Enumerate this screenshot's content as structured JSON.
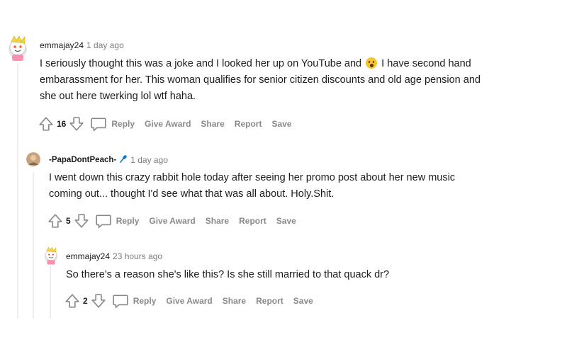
{
  "comments": [
    {
      "username": "emmajay24",
      "time": "1 day ago",
      "text_lines": [
        [
          "I seriously thought this was a joke and I looked her up on YouTube and ",
          "I have second hand"
        ],
        "embarassment for her. This woman qualifies for senior citizen discounts and old age pension and",
        "she out here twerking lol wtf haha."
      ],
      "emoji": "astonished-face-emoji",
      "score": "16",
      "actions": {
        "reply": "Reply",
        "award": "Give Award",
        "share": "Share",
        "report": "Report",
        "save": "Save"
      }
    },
    {
      "username": "-PapaDontPeach-",
      "time": "1 day ago",
      "flair_icon": "microphone-icon",
      "text_lines": [
        "I went down this crazy rabbit hole today after seeing her promo post about her new music",
        "coming out... thought I'd see what that was all about. Holy.Shit."
      ],
      "score": "5",
      "actions": {
        "reply": "Reply",
        "award": "Give Award",
        "share": "Share",
        "report": "Report",
        "save": "Save"
      }
    },
    {
      "username": "emmajay24",
      "time": "23 hours ago",
      "text_lines": [
        "So there's a reason she's like this? Is she still married to that quack dr?"
      ],
      "score": "2",
      "actions": {
        "reply": "Reply",
        "award": "Give Award",
        "share": "Share",
        "report": "Report",
        "save": "Save"
      }
    }
  ]
}
